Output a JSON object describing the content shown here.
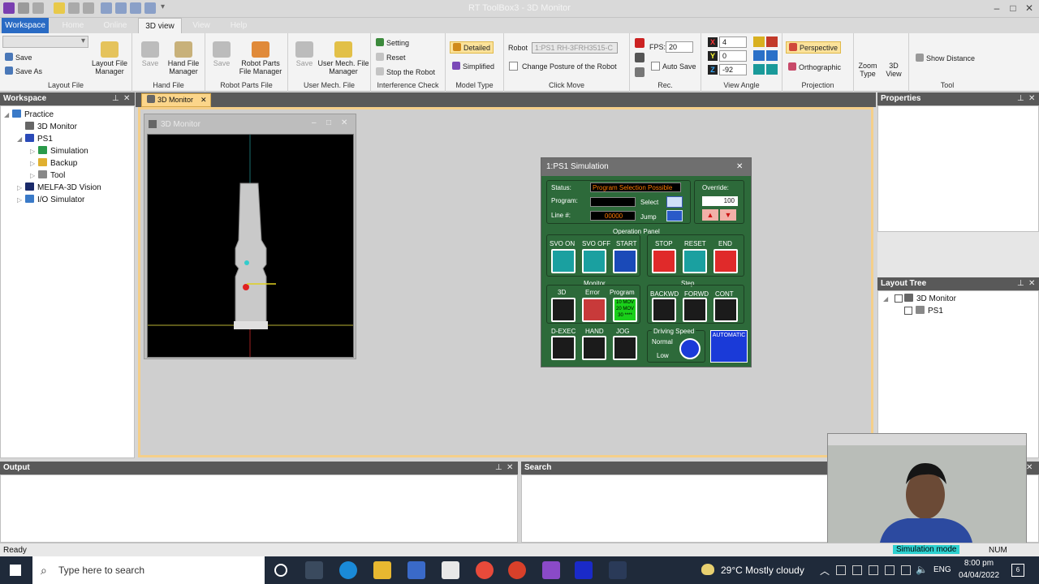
{
  "app": {
    "title": "RT ToolBox3 - 3D Monitor"
  },
  "ribbon_tabs": [
    "Workspace",
    "Home",
    "Online",
    "3D view",
    "View",
    "Help"
  ],
  "ribbon": {
    "workspace_dropdown": "",
    "save": "Save",
    "save_as": "Save As",
    "layout_file_manager": "Layout File Manager",
    "layout_file": "Layout File",
    "hand_save": "Save",
    "hand_file_manager": "Hand File Manager",
    "hand_file": "Hand File",
    "rp_save": "Save",
    "rp_file_manager": "Robot Parts File Manager",
    "rp_file": "Robot Parts File",
    "um_save": "Save",
    "um_file_manager": "User Mech. File Manager",
    "um_file": "User Mech. File",
    "setting": "Setting",
    "reset": "Reset",
    "stop_robot": "Stop the Robot",
    "interference_check": "Interference Check",
    "detailed": "Detailed",
    "simplified": "Simplified",
    "model_type": "Model Type",
    "robot_label": "Robot",
    "robot_value": "1:PS1 RH-3FRH3515-C",
    "change_posture": "Change Posture of the Robot",
    "click_move": "Click Move",
    "fps_label": "FPS:",
    "fps_value": "20",
    "auto_save": "Auto Save",
    "rec": "Rec.",
    "angle_x": "4",
    "angle_y": "0",
    "angle_z": "-92",
    "view_angle": "View Angle",
    "perspective": "Perspective",
    "orthographic": "Orthographic",
    "projection": "Projection",
    "zoom_type": "Zoom Type",
    "view_3d": "3D View",
    "show_distance": "Show Distance",
    "tool": "Tool"
  },
  "workspace_panel": {
    "title": "Workspace",
    "tree": [
      {
        "label": "Practice",
        "icon": "workspace-icon"
      },
      {
        "label": "3D Monitor",
        "icon": "monitor-icon"
      },
      {
        "label": "PS1",
        "icon": "robot-icon"
      },
      {
        "label": "Simulation",
        "icon": "simulation-icon"
      },
      {
        "label": "Backup",
        "icon": "backup-icon"
      },
      {
        "label": "Tool",
        "icon": "tool-icon"
      },
      {
        "label": "MELFA-3D Vision",
        "icon": "vision-icon"
      },
      {
        "label": "I/O Simulator",
        "icon": "io-icon"
      }
    ]
  },
  "doc_tab": "3D Monitor",
  "monitor_window": {
    "title": "3D Monitor"
  },
  "simulation": {
    "title": "1:PS1  Simulation",
    "status_label": "Status:",
    "status_value": "Program Selection Possible",
    "program_label": "Program:",
    "program_value": "",
    "line_label": "Line #:",
    "line_value": "00000",
    "select": "Select",
    "jump": "Jump",
    "override_label": "Override:",
    "override_value": "100",
    "operation_panel": "Operation Panel",
    "svo_on": "SVO ON",
    "svo_off": "SVO OFF",
    "start": "START",
    "stop": "STOP",
    "reset": "RESET",
    "end": "END",
    "monitor": "Monitor",
    "m3d": "3D",
    "error": "Error",
    "program": "Program",
    "prog_icon_text": "10 MOV 20 MOV 30 ****",
    "step": "Step",
    "backwd": "BACKWD",
    "forwd": "FORWD",
    "cont": "CONT",
    "d_exec": "D-EXEC",
    "hand": "HAND",
    "jog": "JOG",
    "driving_speed": "Driving Speed",
    "normal": "Normal",
    "low": "Low",
    "automatic": "AUTOMATIC"
  },
  "properties": {
    "title": "Properties"
  },
  "layout_tree": {
    "title": "Layout Tree",
    "items": [
      "3D Monitor",
      "PS1"
    ]
  },
  "output": {
    "title": "Output"
  },
  "search": {
    "title": "Search"
  },
  "statusbar": {
    "left": "Ready",
    "mode": "Simulation mode",
    "num": "NUM"
  },
  "taskbar": {
    "search_placeholder": "Type here to search",
    "weather": "29°C  Mostly cloudy",
    "lang": "ENG",
    "time": "8:00 pm",
    "date": "04/04/2022",
    "notif": "6"
  }
}
